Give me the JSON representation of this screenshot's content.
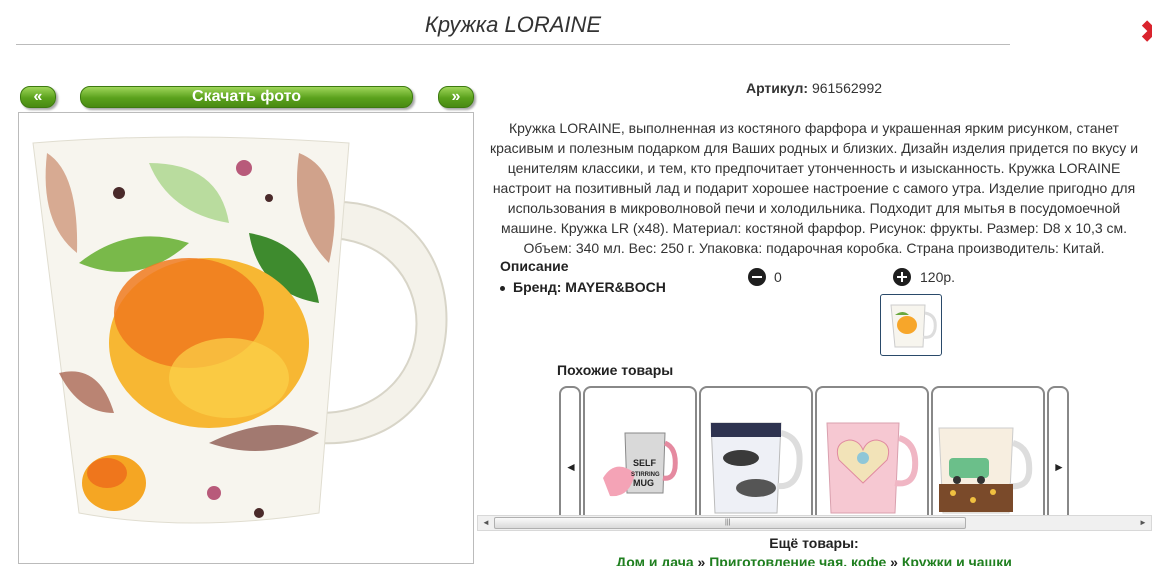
{
  "header": {
    "title": "Кружка LORAINE"
  },
  "gallery": {
    "prev_label": "«",
    "download_label": "Скачать фото",
    "next_label": "»"
  },
  "product": {
    "article_label": "Артикул:",
    "article_value": "961562992",
    "description": "Кружка LORAINE, выполненная из костяного фарфора и украшенная ярким рисунком, станет красивым и полезным подарком для Ваших родных и близких. Дизайн изделия придется по вкусу и ценителям классики, и тем, кто предпочитает утонченность и изысканность. Кружка LORAINE настроит на позитивный лад и подарит хорошее настроение с самого утра. Изделие пригодно для использования в микроволновой печи и холодильника. Подходит для мытья в посудомоечной машине. Кружка LR (x48). Материал: костяной фарфор. Рисунок: фрукты. Размер: D8 x 10,3 см. Объем: 340 мл. Вес: 250 г. Упаковка: подарочная коробка. Страна производитель: Китай.",
    "opisanie_label": "Описание",
    "brand_text": "Бренд: MAYER&BOCH",
    "qty": "0",
    "price": "120р."
  },
  "similar": {
    "title": "Похожие товары",
    "left_arrow": "◄",
    "right_arrow": "►",
    "card3_label": "SELF STIRRING MUG"
  },
  "more": {
    "title": "Ещё товары:",
    "crumb1": "Дом и дача",
    "sep": "»",
    "crumb2": "Приготовление чая, кофе",
    "crumb3": "Кружки и чашки"
  },
  "colors": {
    "green_button": "#5aa11c",
    "link_green": "#1f7f1f",
    "close_red": "#d9232d"
  }
}
